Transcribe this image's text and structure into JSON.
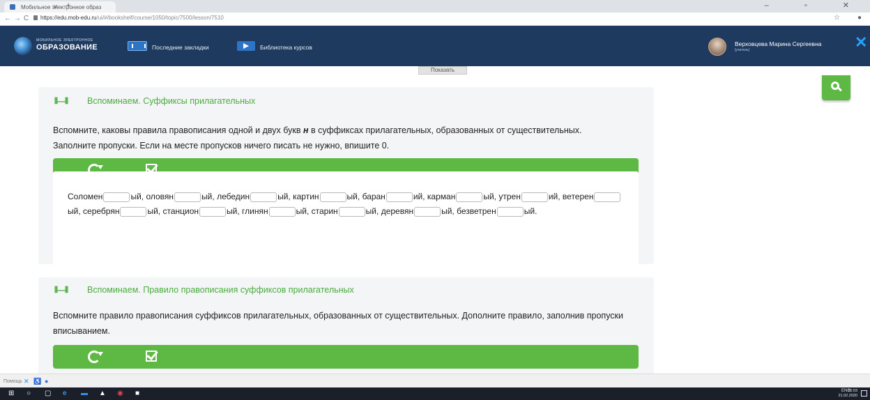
{
  "browser": {
    "tab_title": "Мобильное электронное образ",
    "tab_close": "✕",
    "new_tab": "+",
    "window_controls": "–  ▫  ✕",
    "back": "←",
    "forward": "→",
    "reload": "C",
    "url_host": "https://edu.mob-edu.ru",
    "url_path": "/ui/#/bookshelf/course/1050/topic/7500/lesson/7510",
    "star": "☆",
    "account": "●"
  },
  "header": {
    "logo_small": "МОБИЛЬНОЕ ЭЛЕКТРОННОЕ",
    "logo_big": "ОБРАЗОВАНИЕ",
    "nav_bookmarks": "Последние закладки",
    "nav_library": "Библиотека курсов",
    "user_name": "Верховцева Марина Сергеевна",
    "user_role": "[учитель]",
    "close": "✕"
  },
  "page": {
    "show_label": "Показать",
    "card1": {
      "icon": "⫴—⫴",
      "title": "Вспоминаем. Суффиксы прилагательных",
      "desc": "Вспомните, каковы правила правописания одной и двух букв н в суффиксах прилагательных, образованных от существительных. Заполните пропуски. Если на месте пропусков ничего писать не нужно, впишите 0.",
      "desc_prefix": "Вспомните, каковы правила правописания одной и двух букв ",
      "desc_letter": "н",
      "desc_suffix": " в суффиксах прилагательных, образованных от существительных. Заполните пропуски. Если на месте пропусков ничего писать не нужно, впишите 0.",
      "words": [
        {
          "stem": "Соломен",
          "end": "ый,"
        },
        {
          "stem": "оловян",
          "end": "ый,"
        },
        {
          "stem": "лебедин",
          "end": "ый,"
        },
        {
          "stem": "картин",
          "end": "ый,"
        },
        {
          "stem": "баран",
          "end": "ий,"
        },
        {
          "stem": "карман",
          "end": "ый,"
        },
        {
          "stem": "утрен",
          "end": "ий,"
        },
        {
          "stem": "ветерен",
          "end": "ый,"
        },
        {
          "stem": "серебрян",
          "end": "ый,"
        },
        {
          "stem": "станцион",
          "end": "ый,"
        },
        {
          "stem": "глинян",
          "end": "ый,"
        },
        {
          "stem": "старин",
          "end": "ый,"
        },
        {
          "stem": "деревян",
          "end": "ый,"
        },
        {
          "stem": "безветрен",
          "end": "ый."
        }
      ]
    },
    "card2": {
      "icon": "⫴—⫴",
      "title": "Вспоминаем. Правило правописания суффиксов прилагательных",
      "desc": "Вспомните правило правописания суффиксов прилагательных, образованных от существительных. Дополните правило, заполнив пропуски вписыванием."
    }
  },
  "status": {
    "help": "Помощь"
  },
  "taskbar": {
    "lang": "ENG",
    "time": "15:03",
    "date": "21.02.2020"
  },
  "colors": {
    "header_bg": "#1e3a5f",
    "accent_green": "#5eb844",
    "title_green": "#4bac3f",
    "card_bg": "#f4f5f6"
  }
}
